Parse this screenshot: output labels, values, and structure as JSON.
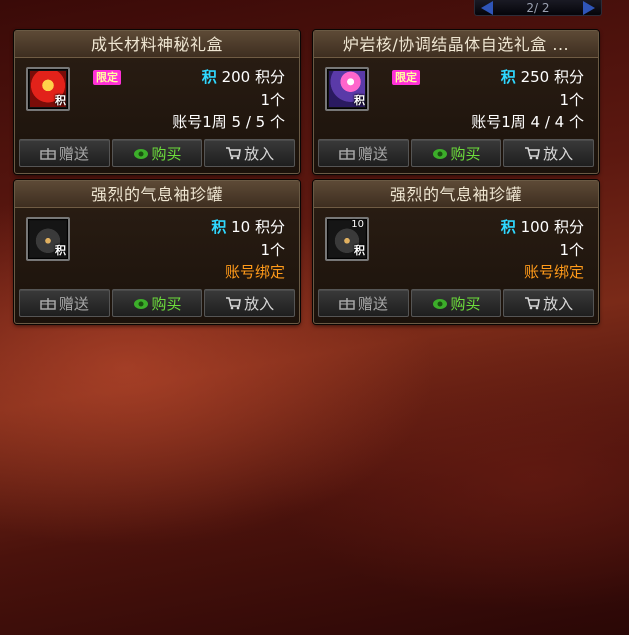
{
  "pager": {
    "text": "2/ 2"
  },
  "labels": {
    "limited": "限定",
    "ji": "积",
    "bind_tag": "积"
  },
  "buttons": {
    "gift": "赠送",
    "buy": "购买",
    "put": "放入"
  },
  "items": [
    {
      "title": "成长材料神秘礼盒",
      "price": "200 积分",
      "qty": "1个",
      "limit": "账号1周 5 / 5 个",
      "limited": true,
      "icon": "red-gift-box-icon"
    },
    {
      "title": "炉岩核/协调结晶体自选礼盒 ...",
      "price": "250 积分",
      "qty": "1个",
      "limit": "账号1周 4 / 4 个",
      "limited": true,
      "icon": "crystal-gift-box-icon"
    },
    {
      "title": "强烈的气息袖珍罐",
      "price": "10 积分",
      "qty": "1个",
      "limit": "账号绑定",
      "limited": false,
      "icon": "pot-icon"
    },
    {
      "title": "强烈的气息袖珍罐",
      "price": "100 积分",
      "qty": "1个",
      "limit": "账号绑定",
      "limited": false,
      "icon": "pot-icon",
      "icon_count": "10"
    }
  ],
  "colors": {
    "accent_ji": "#2fd8ff",
    "bound": "#ff9a1a",
    "limited_bg": "#ff30d8",
    "buy": "#6ddf3c"
  }
}
